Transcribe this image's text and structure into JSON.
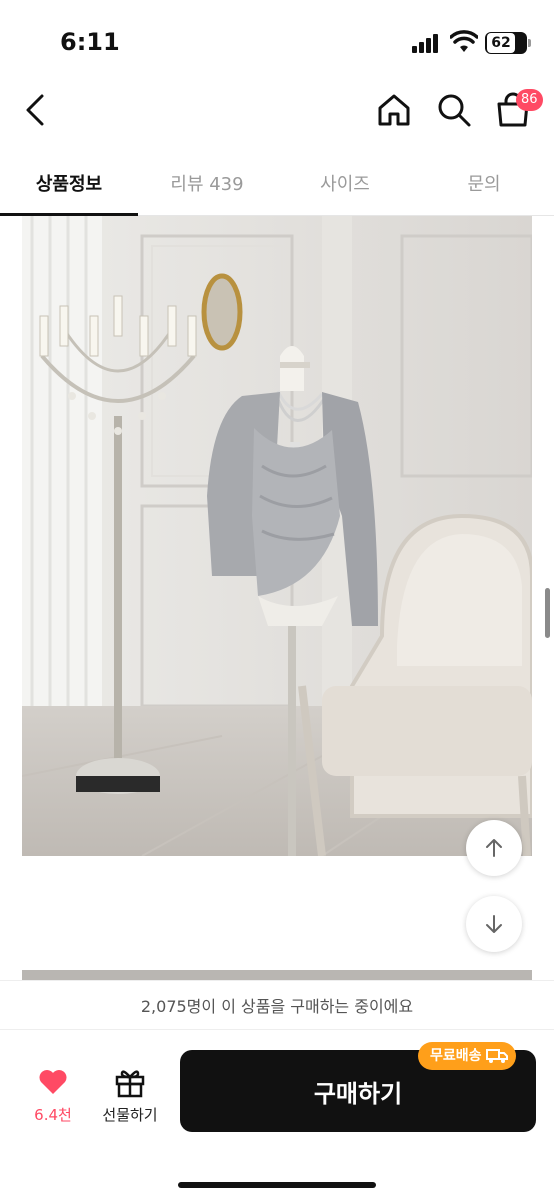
{
  "status_bar": {
    "time": "6:11",
    "battery": "62"
  },
  "header": {
    "cart_badge": "86",
    "icons": [
      "back-icon",
      "home-icon",
      "search-icon",
      "cart-icon"
    ]
  },
  "tabs": [
    {
      "label": "상품정보",
      "active": true
    },
    {
      "label": "리뷰 439",
      "active": false
    },
    {
      "label": "사이즈",
      "active": false
    },
    {
      "label": "문의",
      "active": false
    }
  ],
  "product_image": {
    "description_icon": "product-photo"
  },
  "purchase_info": "2,075명이 이 상품을 구매하는 중이에요",
  "bottom_bar": {
    "like_count": "6.4천",
    "gift_label": "선물하기",
    "buy_label": "구매하기",
    "shipping_badge": "무료배송"
  },
  "colors": {
    "accent_pink": "#ff4a64",
    "badge_orange": "#ff9f1a",
    "buy_button": "#111111"
  }
}
